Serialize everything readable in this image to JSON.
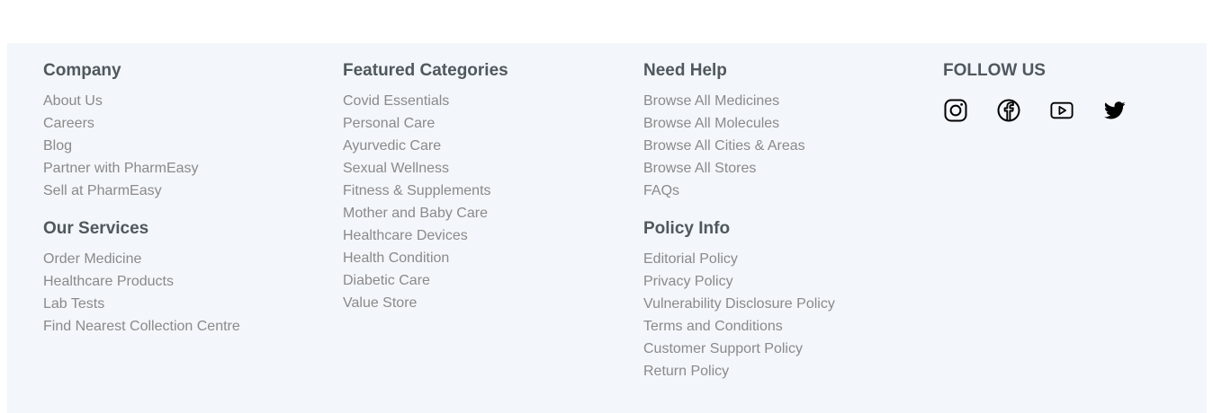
{
  "company": {
    "title": "Company",
    "links": [
      "About Us",
      "Careers",
      "Blog",
      "Partner with PharmEasy",
      "Sell at PharmEasy"
    ]
  },
  "services": {
    "title": "Our Services",
    "links": [
      "Order Medicine",
      "Healthcare Products",
      "Lab Tests",
      "Find Nearest Collection Centre"
    ]
  },
  "categories": {
    "title": "Featured Categories",
    "links": [
      "Covid Essentials",
      "Personal Care",
      "Ayurvedic Care",
      "Sexual Wellness",
      "Fitness & Supplements",
      "Mother and Baby Care",
      "Healthcare Devices",
      "Health Condition",
      "Diabetic Care",
      "Value Store"
    ]
  },
  "help": {
    "title": "Need Help",
    "links": [
      "Browse All Medicines",
      "Browse All Molecules",
      "Browse All Cities & Areas",
      "Browse All Stores",
      "FAQs"
    ]
  },
  "policy": {
    "title": "Policy Info",
    "links": [
      "Editorial Policy",
      "Privacy Policy",
      "Vulnerability Disclosure Policy",
      "Terms and Conditions",
      "Customer Support Policy",
      "Return Policy"
    ]
  },
  "follow": {
    "title": "FOLLOW US",
    "icons": [
      "instagram-icon",
      "facebook-icon",
      "youtube-icon",
      "twitter-icon"
    ]
  },
  "colors": {
    "background": "#f3f6fa",
    "heading": "#4f585e",
    "link": "#8a8a8a",
    "icon": "#000000"
  }
}
